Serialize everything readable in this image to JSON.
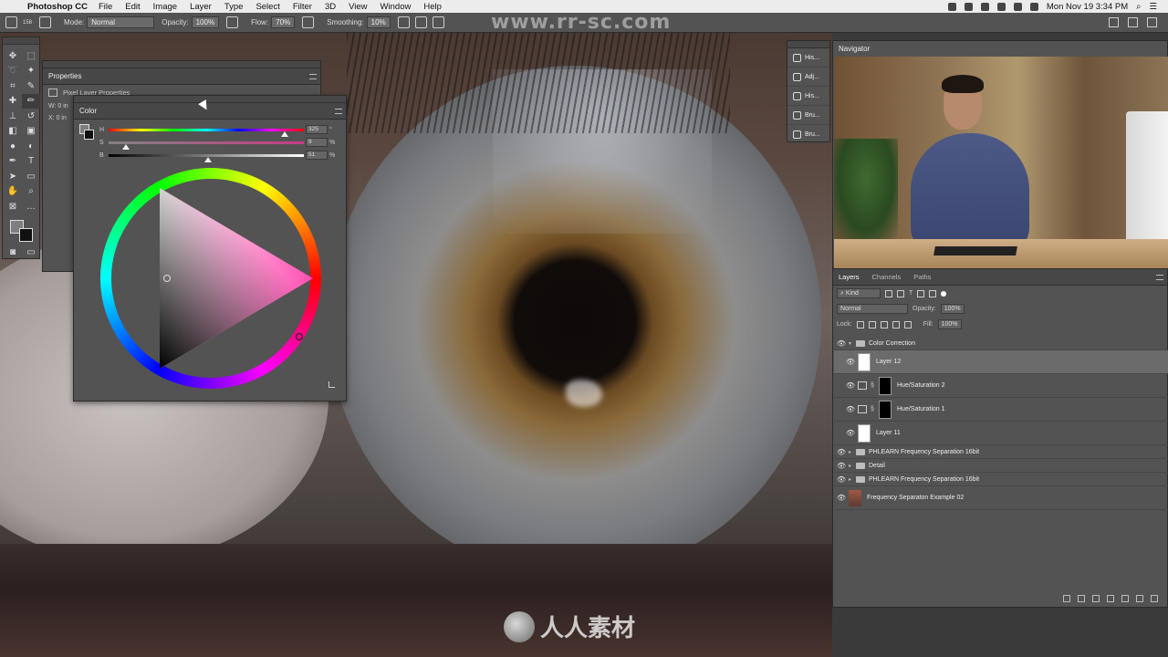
{
  "menubar": {
    "app_name": "Photoshop CC",
    "items": [
      "File",
      "Edit",
      "Image",
      "Layer",
      "Type",
      "Select",
      "Filter",
      "3D",
      "View",
      "Window",
      "Help"
    ],
    "clock": "Mon Nov 19  3:34 PM"
  },
  "options": {
    "brush_size": "158",
    "mode_label": "Mode:",
    "mode_value": "Normal",
    "opacity_label": "Opacity:",
    "opacity_value": "100%",
    "flow_label": "Flow:",
    "flow_value": "70%",
    "smoothing_label": "Smoothing:",
    "smoothing_value": "10%"
  },
  "watermark": {
    "top": "www.rr-sc.com",
    "bottom": "人人素材"
  },
  "properties": {
    "title": "Properties",
    "subtitle": "Pixel Layer Properties",
    "w_label": "W:",
    "w_value": "0 in",
    "x_label": "X:",
    "x_value": "0 in"
  },
  "color_panel": {
    "title": "Color",
    "h_label": "H",
    "s_label": "S",
    "b_label": "B",
    "h_value": "325",
    "s_value": "9",
    "b_value": "51",
    "h_unit": "°",
    "s_unit": "%",
    "b_unit": "%",
    "h_fraction": 0.9,
    "s_fraction": 0.09,
    "b_fraction": 0.51,
    "hue_color": "#ff4fb1"
  },
  "dock": {
    "items": [
      "His...",
      "Adj...",
      "His...",
      "Bru...",
      "Bru..."
    ]
  },
  "navigator": {
    "title": "Navigator"
  },
  "layers_panel": {
    "tabs": [
      "Layers",
      "Channels",
      "Paths"
    ],
    "filter_value": "Kind",
    "blend_value": "Normal",
    "opacity_label": "Opacity:",
    "opacity_value": "100%",
    "lock_label": "Lock:",
    "fill_label": "Fill:",
    "fill_value": "100%",
    "layers": [
      {
        "name": "Color Correction",
        "kind": "group",
        "open": true,
        "selected": false
      },
      {
        "name": "Layer 12",
        "kind": "pixel",
        "selected": true
      },
      {
        "name": "Hue/Saturation 2",
        "kind": "adjustment",
        "selected": false
      },
      {
        "name": "Hue/Saturation 1",
        "kind": "adjustment",
        "selected": false
      },
      {
        "name": "Layer 11",
        "kind": "pixel",
        "selected": false
      },
      {
        "name": "PHLEARN Frequency Separation 16bit",
        "kind": "group",
        "open": false,
        "selected": false
      },
      {
        "name": "Detail",
        "kind": "group",
        "open": false,
        "selected": false
      },
      {
        "name": "PHLEARN Frequency Separation 16bit",
        "kind": "group",
        "open": false,
        "selected": false
      },
      {
        "name": "Frequency Separaton Example 02",
        "kind": "photo",
        "selected": false
      }
    ]
  }
}
